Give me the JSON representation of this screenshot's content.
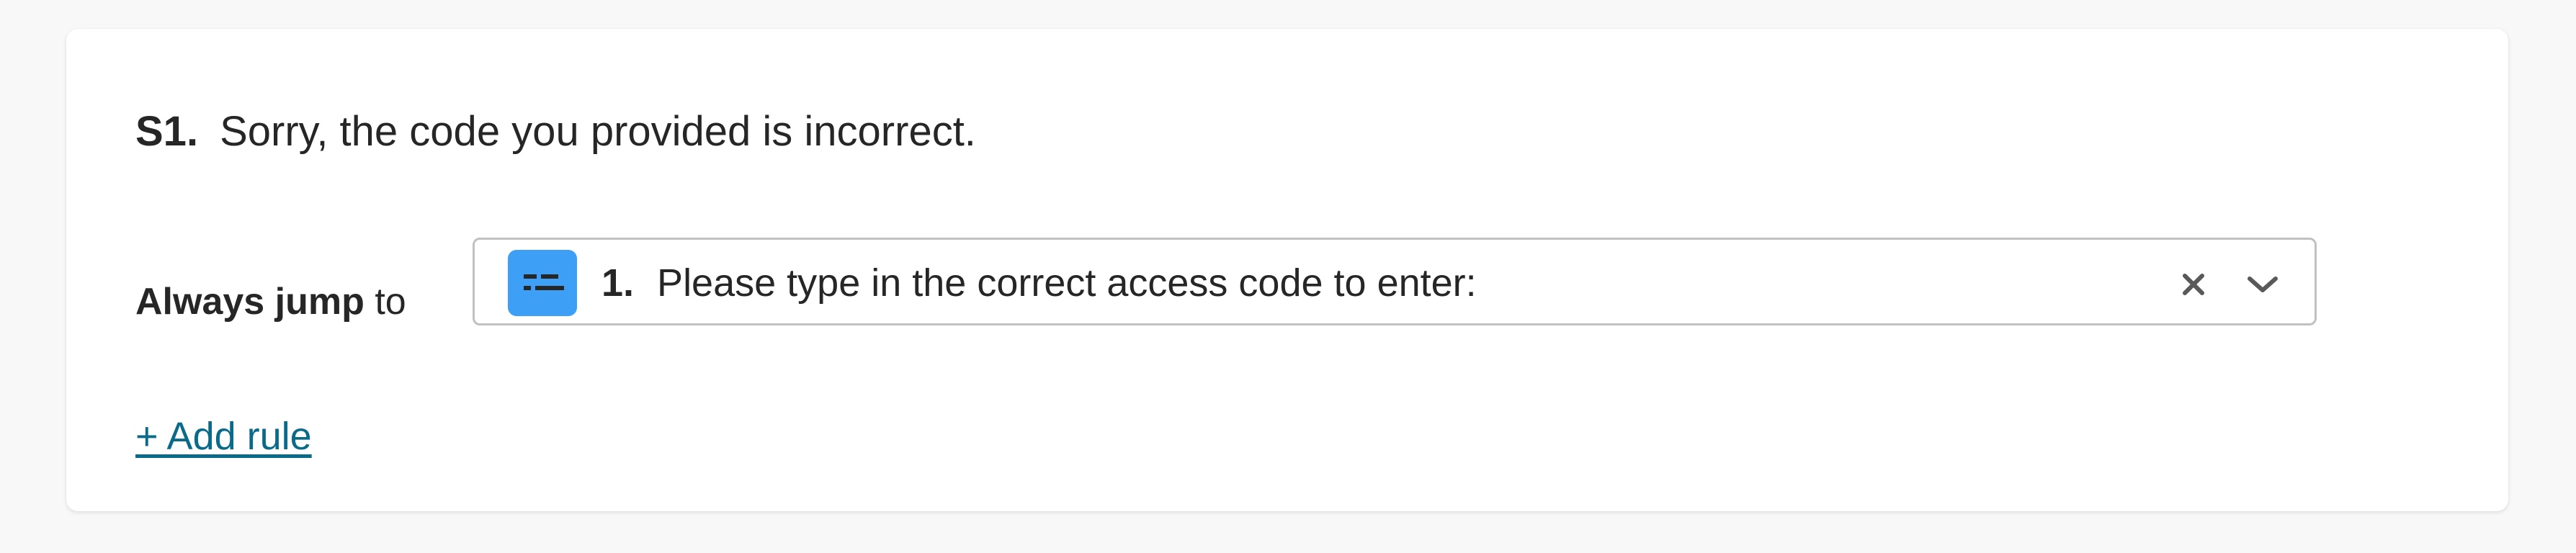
{
  "question": {
    "number": "S1.",
    "text": "Sorry, the code you provided is incorrect."
  },
  "rule": {
    "label_strong": "Always jump",
    "label_rest": "to",
    "selected_option": {
      "number": "1.",
      "text": "Please type in the correct access code to enter:",
      "icon": "short-text-question-icon",
      "icon_color": "#3d9ff5"
    },
    "clear_icon": "close-icon",
    "dropdown_icon": "chevron-down-icon"
  },
  "add_rule_label": "+ Add rule",
  "colors": {
    "link": "#0a6a89",
    "border": "#c1c1c1",
    "background": "#f8f8f8"
  }
}
